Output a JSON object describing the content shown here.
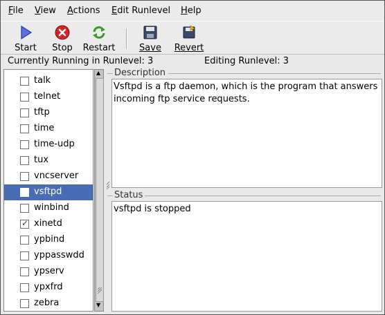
{
  "menubar": {
    "items": [
      {
        "label": "File",
        "u": "F",
        "rest": "ile"
      },
      {
        "label": "View",
        "u": "V",
        "rest": "iew"
      },
      {
        "label": "Actions",
        "u": "A",
        "rest": "ctions"
      },
      {
        "label": "Edit Runlevel",
        "u": "E",
        "rest": "dit Runlevel"
      },
      {
        "label": "Help",
        "u": "H",
        "rest": "elp"
      }
    ]
  },
  "toolbar": {
    "start_label": "Start",
    "stop_label": "Stop",
    "restart_label": "Restart",
    "save_label": "Save",
    "revert_label": "Revert"
  },
  "status": {
    "running": "Currently Running in Runlevel: 3",
    "editing": "Editing Runlevel: 3"
  },
  "services": [
    {
      "name": "talk",
      "checked": false,
      "selected": false
    },
    {
      "name": "telnet",
      "checked": false,
      "selected": false
    },
    {
      "name": "tftp",
      "checked": false,
      "selected": false
    },
    {
      "name": "time",
      "checked": false,
      "selected": false
    },
    {
      "name": "time-udp",
      "checked": false,
      "selected": false
    },
    {
      "name": "tux",
      "checked": false,
      "selected": false
    },
    {
      "name": "vncserver",
      "checked": false,
      "selected": false
    },
    {
      "name": "vsftpd",
      "checked": false,
      "selected": true
    },
    {
      "name": "winbind",
      "checked": false,
      "selected": false
    },
    {
      "name": "xinetd",
      "checked": true,
      "selected": false
    },
    {
      "name": "ypbind",
      "checked": false,
      "selected": false
    },
    {
      "name": "yppasswdd",
      "checked": false,
      "selected": false
    },
    {
      "name": "ypserv",
      "checked": false,
      "selected": false
    },
    {
      "name": "ypxfrd",
      "checked": false,
      "selected": false
    },
    {
      "name": "zebra",
      "checked": false,
      "selected": false
    }
  ],
  "description": {
    "title": "Description",
    "text": "Vsftpd is a ftp daemon, which is the program that answers\nincoming ftp service requests."
  },
  "status_pane": {
    "title": "Status",
    "text": "vsftpd is stopped"
  },
  "colors": {
    "selection": "#4a6bb5",
    "stop_red": "#cc2222",
    "start_blue": "#4a5fd0"
  }
}
